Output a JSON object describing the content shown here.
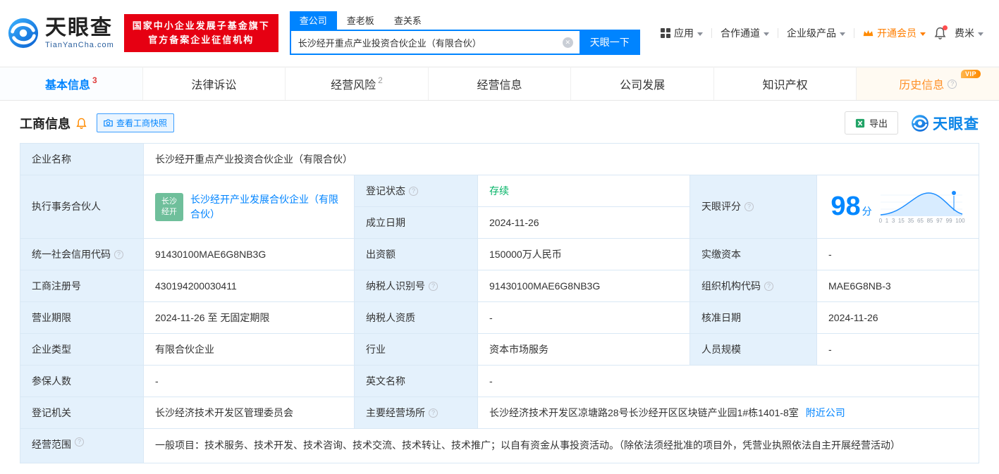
{
  "brand": {
    "name": "天眼查",
    "domain": "TianYanCha.com",
    "badge_line1": "国家中小企业发展子基金旗下",
    "badge_line2": "官方备案企业征信机构"
  },
  "search": {
    "tabs": [
      "查公司",
      "查老板",
      "查关系"
    ],
    "value": "长沙经开重点产业投资合伙企业（有限合伙）",
    "button": "天眼一下"
  },
  "topnav": {
    "apps": "应用",
    "coop": "合作通道",
    "enterprise": "企业级产品",
    "vip": "开通会员",
    "user": "费米"
  },
  "main_tabs": [
    {
      "label": "基本信息",
      "badge": "3"
    },
    {
      "label": "法律诉讼"
    },
    {
      "label": "经营风险",
      "badge": "2"
    },
    {
      "label": "经营信息"
    },
    {
      "label": "公司发展"
    },
    {
      "label": "知识产权"
    },
    {
      "label": "历史信息",
      "vip": "VIP"
    }
  ],
  "section": {
    "title": "工商信息",
    "snapshot_button": "查看工商快照",
    "export_button": "导出",
    "watermark": "天眼查"
  },
  "fields": {
    "name": {
      "label": "企业名称",
      "value": "长沙经开重点产业投资合伙企业（有限合伙）"
    },
    "partner": {
      "label": "执行事务合伙人",
      "avatar_line1": "长沙",
      "avatar_line2": "经开",
      "value": "长沙经开产业发展合伙企业（有限合伙）"
    },
    "reg_status": {
      "label": "登记状态",
      "value": "存续"
    },
    "est_date": {
      "label": "成立日期",
      "value": "2024-11-26"
    },
    "score": {
      "label": "天眼评分",
      "value": "98",
      "unit": "分",
      "ticks": [
        "0",
        "1",
        "3",
        "15",
        "35",
        "65",
        "85",
        "97",
        "99",
        "100"
      ]
    },
    "credit_code": {
      "label": "统一社会信用代码",
      "value": "91430100MAE6G8NB3G"
    },
    "capital": {
      "label": "出资额",
      "value": "150000万人民币"
    },
    "paid_capital": {
      "label": "实缴资本",
      "value": "-"
    },
    "reg_no": {
      "label": "工商注册号",
      "value": "430194200030411"
    },
    "tax_id": {
      "label": "纳税人识别号",
      "value": "91430100MAE6G8NB3G"
    },
    "org_code": {
      "label": "组织机构代码",
      "value": "MAE6G8NB-3"
    },
    "term": {
      "label": "营业期限",
      "value": "2024-11-26 至 无固定期限"
    },
    "tax_quality": {
      "label": "纳税人资质",
      "value": "-"
    },
    "approval_date": {
      "label": "核准日期",
      "value": "2024-11-26"
    },
    "type": {
      "label": "企业类型",
      "value": "有限合伙企业"
    },
    "industry": {
      "label": "行业",
      "value": "资本市场服务"
    },
    "staff": {
      "label": "人员规模",
      "value": "-"
    },
    "insured": {
      "label": "参保人数",
      "value": "-"
    },
    "english_name": {
      "label": "英文名称",
      "value": "-"
    },
    "authority": {
      "label": "登记机关",
      "value": "长沙经济技术开发区管理委员会"
    },
    "address": {
      "label": "主要经营场所",
      "value": "长沙经济技术开发区凉塘路28号长沙经开区区块链产业园1#栋1401-8室",
      "link": "附近公司"
    },
    "scope": {
      "label": "经营范围",
      "value": "一般项目：技术服务、技术开发、技术咨询、技术交流、技术转让、技术推广；以自有资金从事投资活动。（除依法须经批准的项目外，凭营业执照依法自主开展经营活动）"
    }
  }
}
